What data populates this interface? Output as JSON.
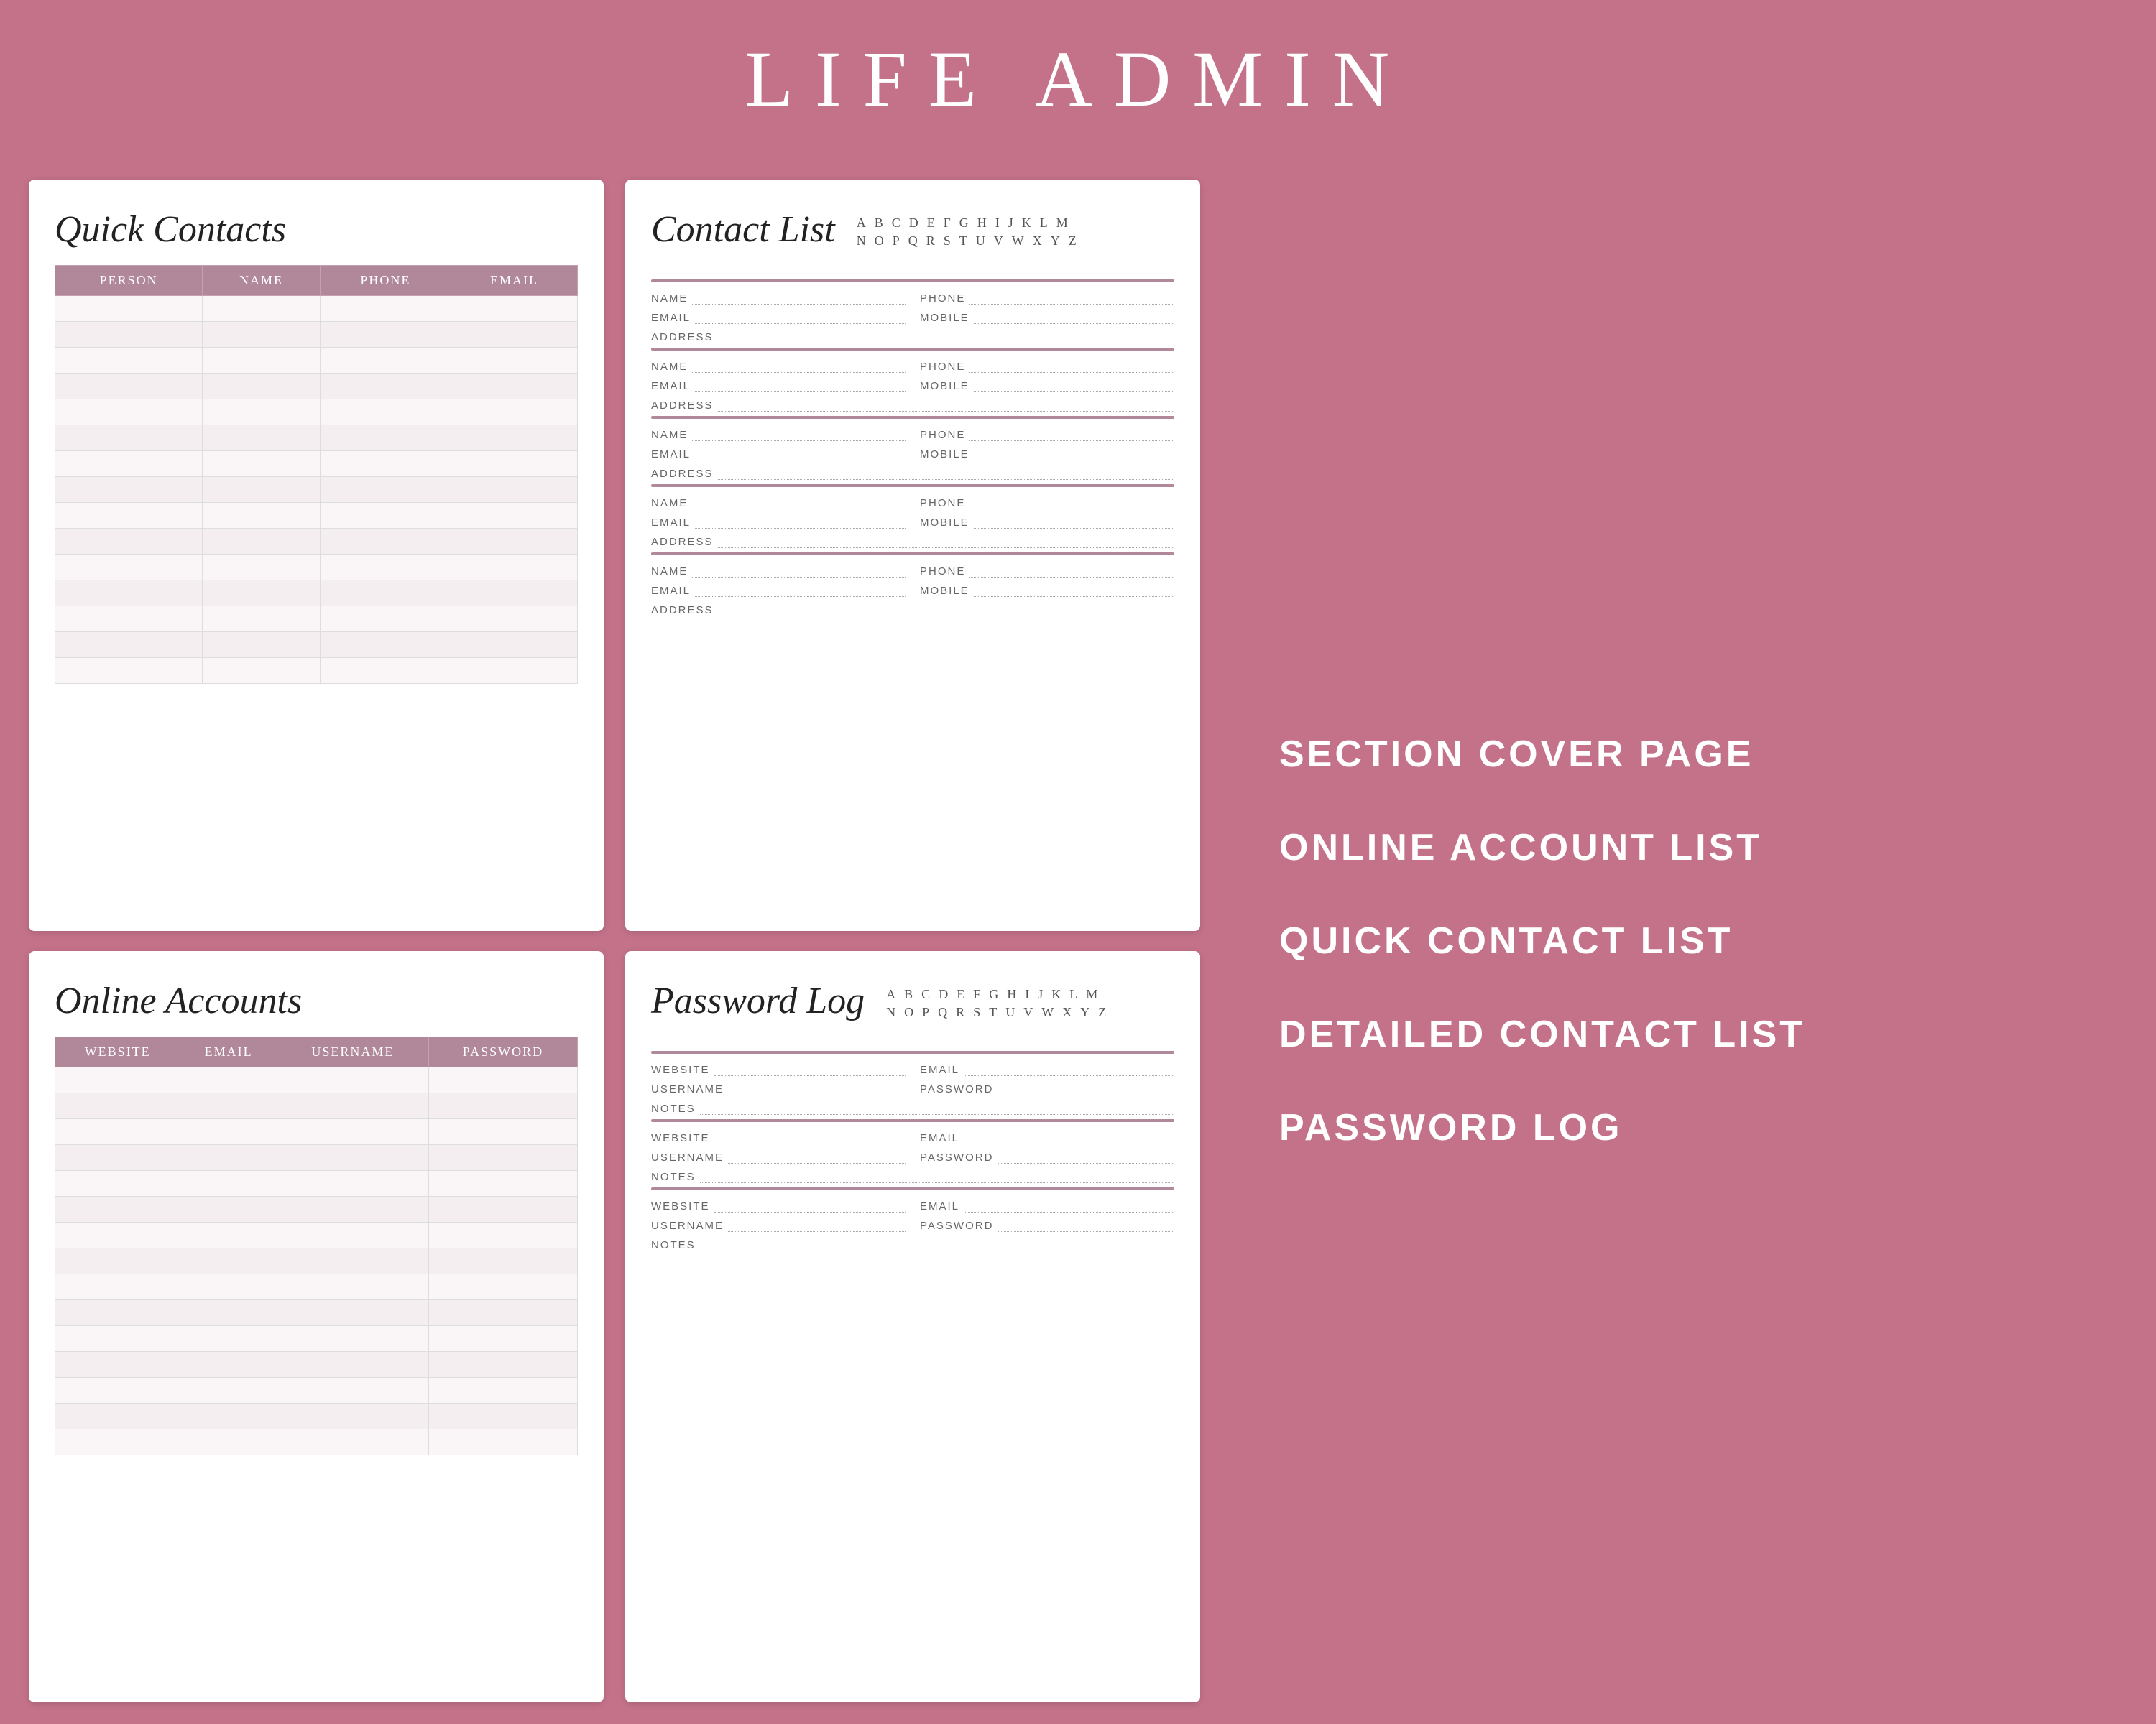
{
  "header": {
    "title": "LIFE ADMIN"
  },
  "sidebar": {
    "items": [
      {
        "id": "section-cover",
        "label": "SECTION COVER PAGE"
      },
      {
        "id": "online-account",
        "label": "ONLINE ACCOUNT LIST"
      },
      {
        "id": "quick-contact",
        "label": "QUICK CONTACT LIST"
      },
      {
        "id": "detailed-contact",
        "label": "DETAILED CONTACT LIST"
      },
      {
        "id": "password-log",
        "label": "PASSWORD LOG"
      }
    ]
  },
  "quick_contacts": {
    "title": "Quick Contacts",
    "columns": [
      "PERSON",
      "NAME",
      "PHONE",
      "EMAIL"
    ],
    "rows": 15
  },
  "contact_list": {
    "title": "Contact List",
    "alphabet_row1": [
      "A",
      "B",
      "C",
      "D",
      "E",
      "F",
      "G",
      "H",
      "I",
      "J",
      "K",
      "L",
      "M"
    ],
    "alphabet_row2": [
      "N",
      "O",
      "P",
      "Q",
      "R",
      "S",
      "T",
      "U",
      "V",
      "W",
      "X",
      "Y",
      "Z"
    ],
    "entries": [
      {
        "fields": [
          "NAME",
          "PHONE",
          "EMAIL",
          "MOBILE",
          "ADDRESS"
        ]
      },
      {
        "fields": [
          "NAME",
          "PHONE",
          "EMAIL",
          "MOBILE",
          "ADDRESS"
        ]
      },
      {
        "fields": [
          "NAME",
          "PHONE",
          "EMAIL",
          "MOBILE",
          "ADDRESS"
        ]
      },
      {
        "fields": [
          "NAME",
          "PHONE",
          "EMAIL",
          "MOBILE",
          "ADDRESS"
        ]
      },
      {
        "fields": [
          "NAME",
          "PHONE",
          "EMAIL",
          "MOBILE",
          "ADDRESS"
        ]
      }
    ]
  },
  "online_accounts": {
    "title": "Online Accounts",
    "columns": [
      "WEBSITE",
      "EMAIL",
      "USERNAME",
      "PASSWORD"
    ],
    "rows": 15
  },
  "password_log": {
    "title": "Password Log",
    "alphabet_row1": [
      "A",
      "B",
      "C",
      "D",
      "E",
      "F",
      "G",
      "H",
      "I",
      "J",
      "K",
      "L",
      "M"
    ],
    "alphabet_row2": [
      "N",
      "O",
      "P",
      "Q",
      "R",
      "S",
      "T",
      "U",
      "V",
      "W",
      "X",
      "Y",
      "Z"
    ],
    "entries": [
      {
        "fields": [
          "WEBSITE",
          "EMAIL",
          "USERNAME",
          "PASSWORD",
          "NOTES"
        ]
      },
      {
        "fields": [
          "WEBSITE",
          "EMAIL",
          "USERNAME",
          "PASSWORD",
          "NOTES"
        ]
      },
      {
        "fields": [
          "WEBSITE",
          "EMAIL",
          "USERNAME",
          "PASSWORD",
          "NOTES"
        ]
      }
    ]
  }
}
